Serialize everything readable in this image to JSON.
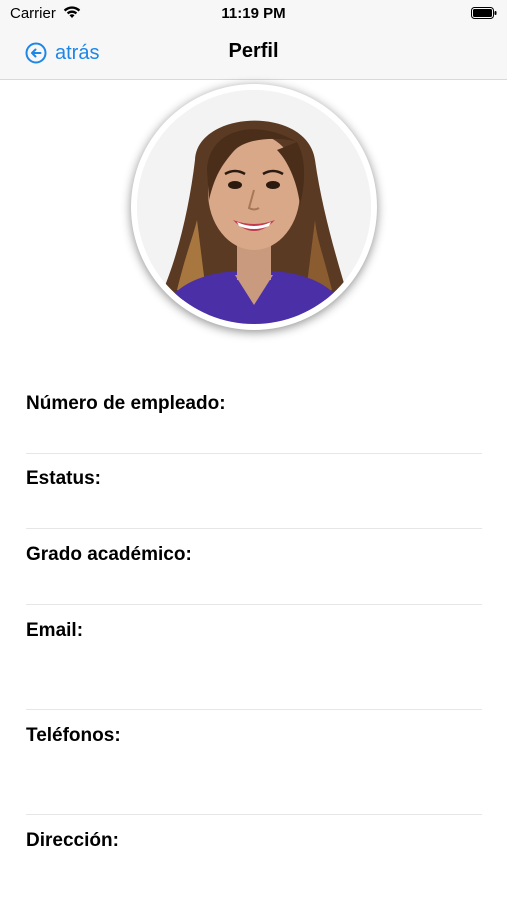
{
  "status_bar": {
    "carrier": "Carrier",
    "time": "11:19 PM"
  },
  "nav": {
    "back_label": "atrás",
    "title": "Perfil"
  },
  "colors": {
    "accent": "#1e86e6",
    "divider": "#e6e6e6",
    "shirt": "#4b2fa6"
  },
  "fields": [
    {
      "label": "Número de empleado:",
      "value": ""
    },
    {
      "label": "Estatus:",
      "value": ""
    },
    {
      "label": "Grado académico:",
      "value": ""
    },
    {
      "label": "Email:",
      "value": ""
    },
    {
      "label": "Teléfonos:",
      "value": ""
    },
    {
      "label": "Dirección:",
      "value": ""
    }
  ]
}
